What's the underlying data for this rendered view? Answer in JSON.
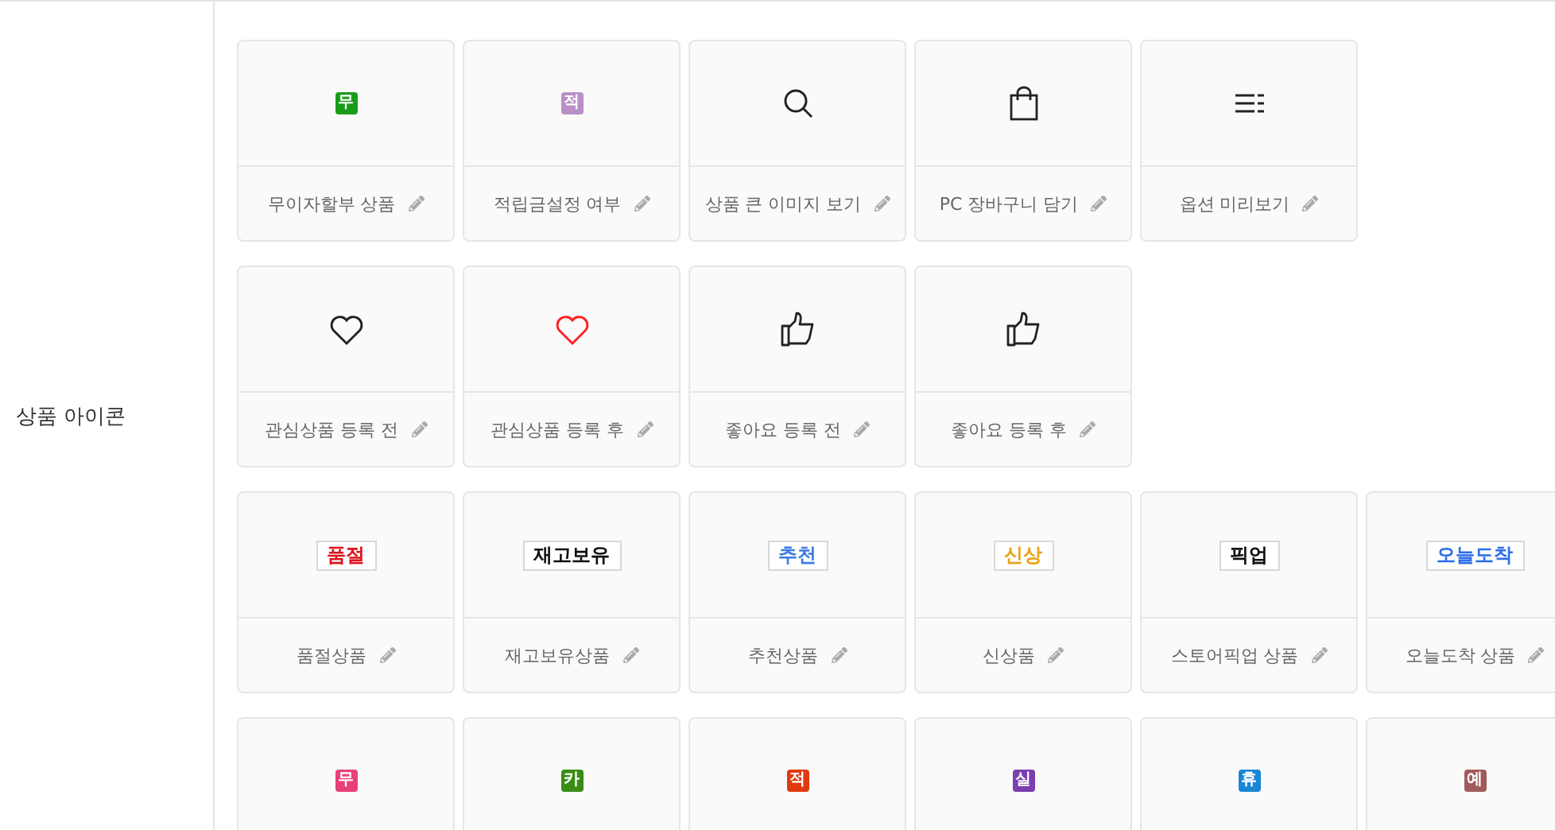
{
  "section": {
    "label": "상품 아이콘"
  },
  "rows": [
    {
      "items": [
        {
          "kind": "badge",
          "glyph": "무",
          "color": "#1a9c1a",
          "label": "무이자할부 상품"
        },
        {
          "kind": "badge",
          "glyph": "적",
          "color": "#b98fc7",
          "label": "적립금설정 여부"
        },
        {
          "kind": "search",
          "color": "#222222",
          "label": "상품 큰 이미지 보기"
        },
        {
          "kind": "bag",
          "color": "#222222",
          "label": "PC 장바구니 담기"
        },
        {
          "kind": "list",
          "color": "#222222",
          "label": "옵션 미리보기"
        }
      ]
    },
    {
      "items": [
        {
          "kind": "heart",
          "color": "#222222",
          "label": "관심상품 등록 전"
        },
        {
          "kind": "heart",
          "color": "#ff2020",
          "label": "관심상품 등록 후"
        },
        {
          "kind": "thumb",
          "color": "#222222",
          "label": "좋아요 등록 전"
        },
        {
          "kind": "thumb",
          "color": "#222222",
          "label": "좋아요 등록 후"
        }
      ]
    },
    {
      "items": [
        {
          "kind": "tag",
          "glyph": "품절",
          "color": "#e0141e",
          "label": "품절상품"
        },
        {
          "kind": "tag",
          "glyph": "재고보유",
          "color": "#111111",
          "label": "재고보유상품"
        },
        {
          "kind": "tag",
          "glyph": "추천",
          "color": "#3d7be3",
          "label": "추천상품"
        },
        {
          "kind": "tag",
          "glyph": "신상",
          "color": "#e8a317",
          "label": "신상품"
        },
        {
          "kind": "tag",
          "glyph": "픽업",
          "color": "#111111",
          "label": "스토어픽업 상품"
        },
        {
          "kind": "tag",
          "glyph": "오늘도착",
          "color": "#2f6fe8",
          "label": "오늘도착 상품"
        }
      ]
    },
    {
      "items": [
        {
          "kind": "badge",
          "glyph": "무",
          "color": "#e8407a"
        },
        {
          "kind": "badge",
          "glyph": "카",
          "color": "#3a8c14"
        },
        {
          "kind": "badge",
          "glyph": "적",
          "color": "#e03a10"
        },
        {
          "kind": "badge",
          "glyph": "실",
          "color": "#7a3fb0"
        },
        {
          "kind": "badge",
          "glyph": "휴",
          "color": "#1a86d6"
        },
        {
          "kind": "badge",
          "glyph": "예",
          "color": "#a05a5a"
        }
      ]
    }
  ]
}
